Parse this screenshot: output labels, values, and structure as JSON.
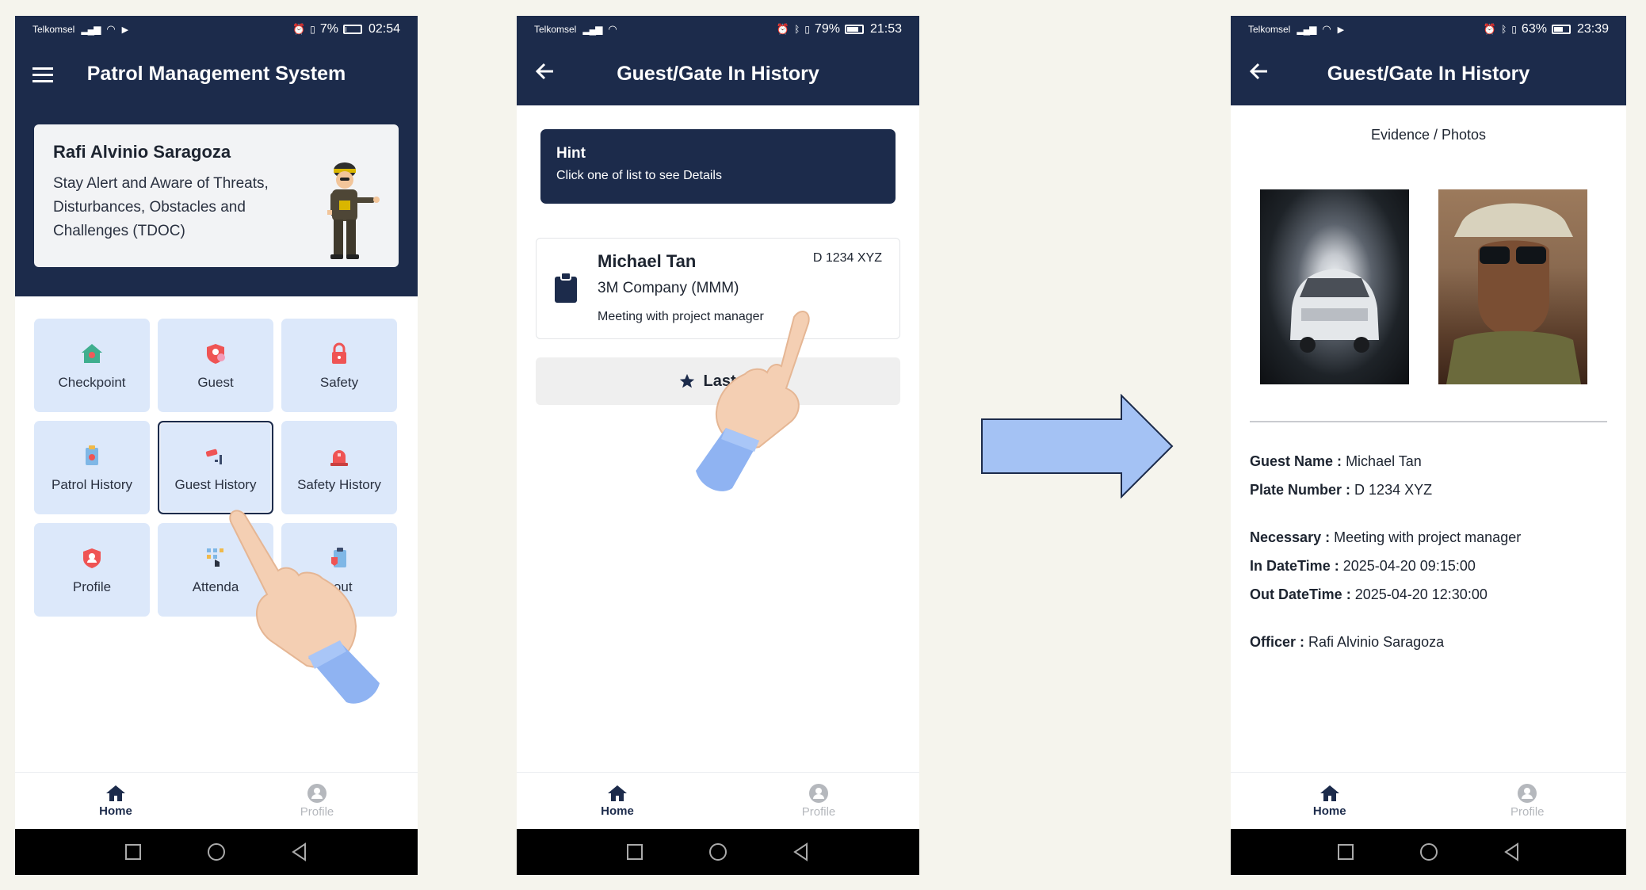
{
  "phone1": {
    "status": {
      "carrier": "Telkomsel",
      "battery": "7%",
      "time": "02:54",
      "battery_level": 0.07
    },
    "appbar": {
      "title": "Patrol Management System"
    },
    "card": {
      "name": "Rafi Alvinio Saragoza",
      "message": "Stay Alert and Aware of Threats, Disturbances, Obstacles and Challenges (TDOC)"
    },
    "menu": [
      {
        "label": "Checkpoint",
        "icon": "checkpoint-icon"
      },
      {
        "label": "Guest",
        "icon": "guest-icon"
      },
      {
        "label": "Safety",
        "icon": "safety-icon"
      },
      {
        "label": "Patrol History",
        "icon": "patrol-history-icon"
      },
      {
        "label": "Guest History",
        "icon": "guest-history-icon",
        "selected": true
      },
      {
        "label": "Safety History",
        "icon": "safety-history-icon"
      },
      {
        "label": "Profile",
        "icon": "profile-icon"
      },
      {
        "label": "Attenda",
        "icon": "attendance-icon"
      },
      {
        "label": "gout",
        "icon": "logout-icon"
      }
    ],
    "nav": {
      "home": "Home",
      "profile": "Profile"
    }
  },
  "phone2": {
    "status": {
      "carrier": "Telkomsel",
      "battery": "79%",
      "time": "21:53",
      "battery_level": 0.79
    },
    "appbar": {
      "title": "Guest/Gate In History"
    },
    "hint": {
      "title": "Hint",
      "text": "Click one of list to see Details"
    },
    "guest": {
      "name": "Michael Tan",
      "company": "3M Company (MMM)",
      "necessary": "Meeting with project manager",
      "plate": "D 1234 XYZ"
    },
    "button": {
      "label": "Last 10"
    },
    "nav": {
      "home": "Home",
      "profile": "Profile"
    }
  },
  "phone3": {
    "status": {
      "carrier": "Telkomsel",
      "battery": "63%",
      "time": "23:39",
      "battery_level": 0.63
    },
    "appbar": {
      "title": "Guest/Gate In History"
    },
    "evidence_title": "Evidence / Photos",
    "details": {
      "guest_name_label": "Guest Name :",
      "guest_name": "Michael Tan",
      "plate_label": "Plate Number :",
      "plate": "D 1234 XYZ",
      "necessary_label": "Necessary :",
      "necessary": "Meeting with project manager",
      "in_label": "In DateTime :",
      "in_time": "2025-04-20 09:15:00",
      "out_label": "Out DateTime :",
      "out_time": "2025-04-20 12:30:00",
      "officer_label": "Officer :",
      "officer": "Rafi Alvinio Saragoza"
    },
    "nav": {
      "home": "Home",
      "profile": "Profile"
    }
  },
  "colors": {
    "navy": "#1c2b4b",
    "tile": "#dce8fa",
    "arrow": "#a4c2f4",
    "background": "#f5f4ed"
  }
}
